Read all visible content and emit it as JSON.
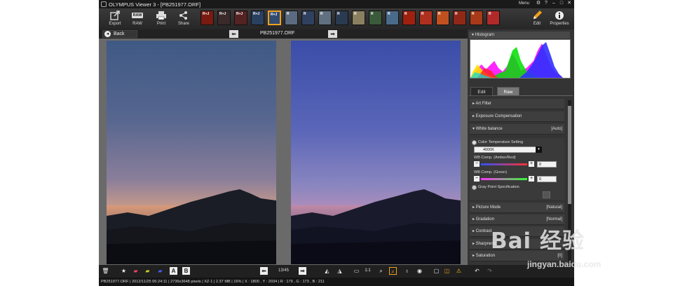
{
  "window": {
    "title": "OLYMPUS Viewer 3 - [PB251977.ORF]",
    "menu": "Menu",
    "controls": [
      "⚙",
      "?",
      "–",
      "□",
      "✕"
    ]
  },
  "toolbar": {
    "export": "Export",
    "raw": "RAW",
    "raw_icon_text": "RAW",
    "print": "Print",
    "share": "Share",
    "edit": "Edit",
    "properties": "Properties",
    "thumbs": [
      {
        "tag": "R+J",
        "color": "#7a1a10"
      },
      {
        "tag": "R+J",
        "color": "#3a2a2a"
      },
      {
        "tag": "R+J",
        "color": "#552222"
      },
      {
        "tag": "R+J",
        "color": "#2a4060"
      },
      {
        "tag": "R+J",
        "color": "#304a70"
      },
      {
        "tag": "R",
        "color": "#5a6a80"
      },
      {
        "tag": "R",
        "color": "#304060"
      },
      {
        "tag": "R",
        "color": "#607080"
      },
      {
        "tag": "R",
        "color": "#2a3a50"
      },
      {
        "tag": "R",
        "color": "#8a8060"
      },
      {
        "tag": "R",
        "color": "#3a5a3a"
      },
      {
        "tag": "R",
        "color": "#4a6a8a"
      },
      {
        "tag": "R",
        "color": "#a02010"
      },
      {
        "tag": "R",
        "color": "#b03020"
      },
      {
        "tag": "R",
        "color": "#c05020"
      },
      {
        "tag": "R",
        "color": "#902818"
      },
      {
        "tag": "R",
        "color": "#a83a18"
      },
      {
        "tag": "R",
        "color": "#b02a2a"
      }
    ]
  },
  "nav": {
    "back": "Back",
    "filename": "PB251977.ORF"
  },
  "bottom": {
    "counter": "13/45",
    "icons": [
      "trash",
      "star",
      "label-1",
      "label-2",
      "label-3",
      "A",
      "B",
      "prev",
      "next",
      "view-a",
      "view-b",
      "fit",
      "1:1",
      "zoom",
      "loupe",
      "eye",
      "single",
      "compare",
      "warning"
    ]
  },
  "status": "PB251977.ORF | 2012/11/25 06:24:11 | 2736x3648 pixels | XZ-1 | 2.37 MB | 16% | X : 1800 , Y : 2034 | R : 179 , G : 173 , B : 211",
  "panel": {
    "histogram": "Histogram",
    "tabs": [
      "Edit",
      "Raw"
    ],
    "art_filter": "Art Filter",
    "exposure": "Exposure Compensation",
    "white_balance": "White balance",
    "white_balance_value": "[Auto]",
    "color_temp": "Color Temperature Setting",
    "color_temp_value": "4000K",
    "wb_amber": "WB Comp. (Amber/Red)",
    "wb_amber_value": "0",
    "wb_green": "WB Comp. (Green)",
    "wb_green_value": "0",
    "gray_point": "Gray Point Specification",
    "picture_mode": "Picture Mode",
    "picture_mode_value": "[Natural]",
    "gradation": "Gradation",
    "gradation_value": "[Normal]",
    "contrast": "Contrast",
    "sharpness": "Sharpness",
    "saturation": "Saturation",
    "saturation_value": "[0]"
  },
  "watermark": {
    "brand": "Bai 经验",
    "url": "jingyan.baidu.com"
  }
}
